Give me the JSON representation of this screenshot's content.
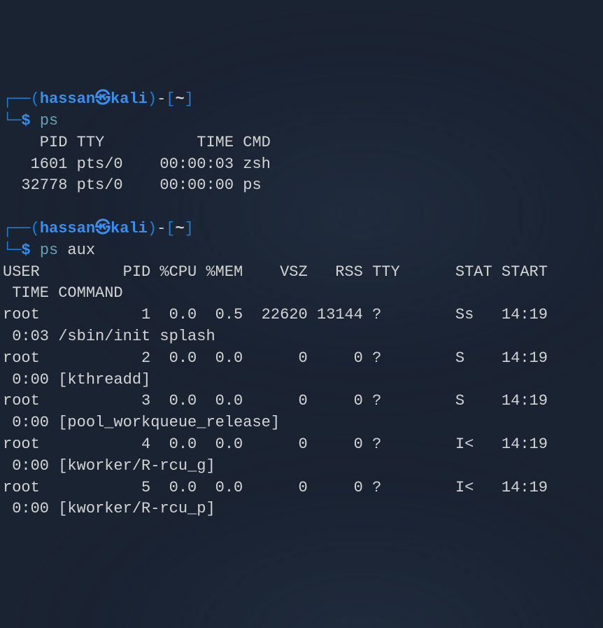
{
  "prompt1": {
    "corner_top": "┌──",
    "paren_open": "(",
    "user": "hassan",
    "skull": "㉿",
    "host": "kali",
    "paren_close": ")",
    "dash": "-",
    "bracket_open": "[",
    "tilde": "~",
    "bracket_close": "]",
    "corner_bot": "└─",
    "dollar": "$",
    "cmd": "ps"
  },
  "ps_output": {
    "header": "    PID TTY          TIME CMD",
    "row1": "   1601 pts/0    00:00:03 zsh",
    "row2": "  32778 pts/0    00:00:00 ps"
  },
  "prompt2": {
    "corner_top": "┌──",
    "paren_open": "(",
    "user": "hassan",
    "skull": "㉿",
    "host": "kali",
    "paren_close": ")",
    "dash": "-",
    "bracket_open": "[",
    "tilde": "~",
    "bracket_close": "]",
    "corner_bot": "└─",
    "dollar": "$",
    "cmd": "ps",
    "args": "aux"
  },
  "psaux_output": {
    "header1": "USER         PID %CPU %MEM    VSZ   RSS TTY      STAT START  ",
    "header2": " TIME COMMAND",
    "r1a": "root           1  0.0  0.5  22620 13144 ?        Ss   14:19  ",
    "r1b": " 0:03 /sbin/init splash",
    "r2a": "root           2  0.0  0.0      0     0 ?        S    14:19  ",
    "r2b": " 0:00 [kthreadd]",
    "r3a": "root           3  0.0  0.0      0     0 ?        S    14:19  ",
    "r3b": " 0:00 [pool_workqueue_release]",
    "r4a": "root           4  0.0  0.0      0     0 ?        I<   14:19  ",
    "r4b": " 0:00 [kworker/R-rcu_g]",
    "r5a": "root           5  0.0  0.0      0     0 ?        I<   14:19  ",
    "r5b": " 0:00 [kworker/R-rcu_p]"
  }
}
